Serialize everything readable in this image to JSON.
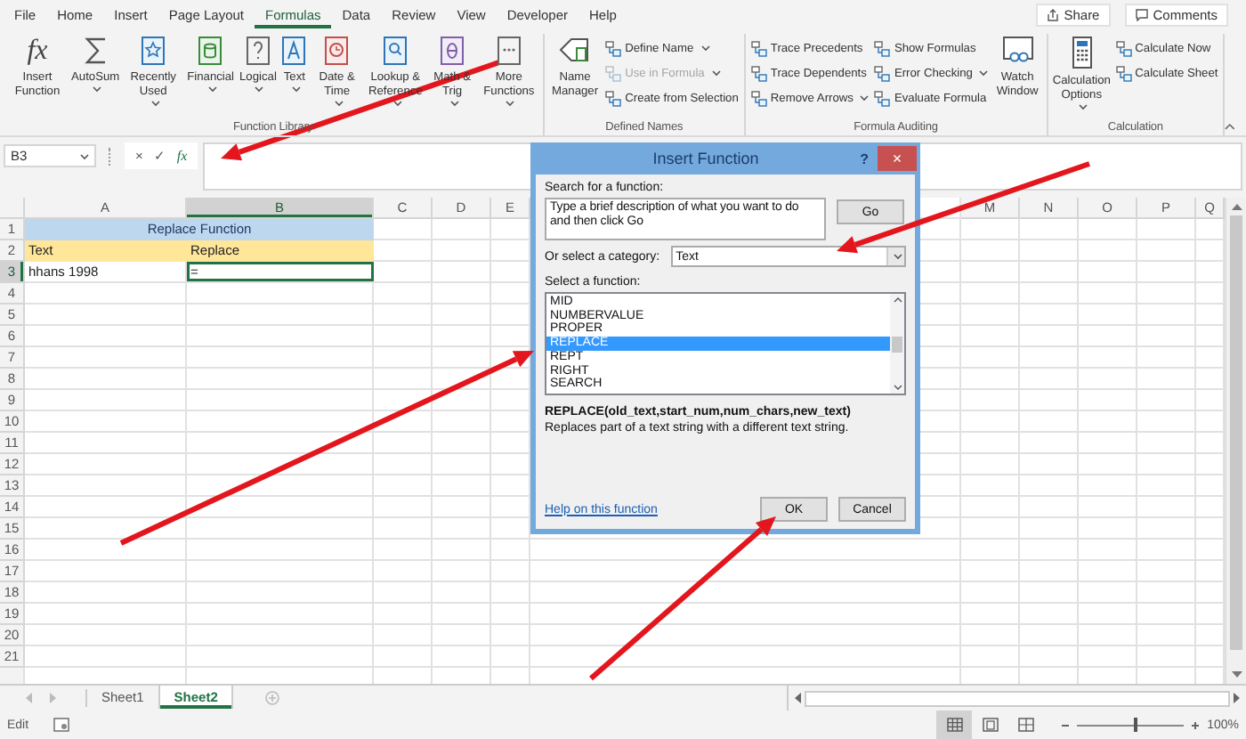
{
  "ribbon_tabs": [
    {
      "label": "File",
      "selected": false
    },
    {
      "label": "Home",
      "selected": false
    },
    {
      "label": "Insert",
      "selected": false
    },
    {
      "label": "Page Layout",
      "selected": false
    },
    {
      "label": "Formulas",
      "selected": true
    },
    {
      "label": "Data",
      "selected": false
    },
    {
      "label": "Review",
      "selected": false
    },
    {
      "label": "View",
      "selected": false
    },
    {
      "label": "Developer",
      "selected": false
    },
    {
      "label": "Help",
      "selected": false
    }
  ],
  "share": "Share",
  "comments": "Comments",
  "ribbon_groups": [
    {
      "label": "Function Library",
      "items": [
        {
          "kind": "large",
          "label": "Insert Function",
          "glyph": "fx",
          "dropdown": false,
          "disabled": false
        },
        {
          "kind": "large",
          "label": "AutoSum",
          "dropdown": true,
          "disabled": false
        },
        {
          "kind": "large",
          "label": "Recently Used",
          "dropdown": true,
          "disabled": false
        },
        {
          "kind": "large",
          "label": "Financial",
          "dropdown": true,
          "disabled": false
        },
        {
          "kind": "large",
          "label": "Logical",
          "dropdown": true,
          "disabled": false
        },
        {
          "kind": "large",
          "label": "Text",
          "dropdown": true,
          "disabled": false
        },
        {
          "kind": "large",
          "label": "Date & Time",
          "dropdown": true,
          "disabled": false
        },
        {
          "kind": "large",
          "label": "Lookup & Reference",
          "dropdown": true,
          "disabled": false
        },
        {
          "kind": "large",
          "label": "Math & Trig",
          "dropdown": true,
          "disabled": false
        },
        {
          "kind": "large",
          "label": "More Functions",
          "dropdown": true,
          "disabled": false
        }
      ]
    },
    {
      "label": "Defined Names",
      "items": [
        {
          "kind": "large",
          "label": "Name Manager",
          "dropdown": false,
          "disabled": false
        },
        {
          "kind": "small",
          "label": "Define Name",
          "dropdown": true,
          "disabled": false
        },
        {
          "kind": "small",
          "label": "Use in Formula",
          "dropdown": true,
          "disabled": true
        },
        {
          "kind": "small",
          "label": "Create from Selection",
          "dropdown": false,
          "disabled": false
        }
      ]
    },
    {
      "label": "Formula Auditing",
      "items": [
        {
          "kind": "small",
          "label": "Trace Precedents",
          "dropdown": false,
          "disabled": false
        },
        {
          "kind": "small",
          "label": "Trace Dependents",
          "dropdown": false,
          "disabled": false
        },
        {
          "kind": "small",
          "label": "Remove Arrows",
          "dropdown": true,
          "disabled": false
        },
        {
          "kind": "small",
          "label": "Show Formulas",
          "dropdown": false,
          "disabled": false
        },
        {
          "kind": "small",
          "label": "Error Checking",
          "dropdown": true,
          "disabled": false
        },
        {
          "kind": "small",
          "label": "Evaluate Formula",
          "dropdown": false,
          "disabled": false
        },
        {
          "kind": "large",
          "label": "Watch Window",
          "dropdown": false,
          "disabled": false
        }
      ]
    },
    {
      "label": "Calculation",
      "items": [
        {
          "kind": "large",
          "label": "Calculation Options",
          "dropdown": true,
          "disabled": false
        },
        {
          "kind": "small",
          "label": "Calculate Now",
          "dropdown": false,
          "disabled": false
        },
        {
          "kind": "small",
          "label": "Calculate Sheet",
          "dropdown": false,
          "disabled": false
        }
      ]
    }
  ],
  "formula_bar": {
    "name_box": "B3",
    "cancel": "×",
    "enter": "✓",
    "function": "fx"
  },
  "sheet": {
    "columns": [
      {
        "label": "A",
        "selected": false
      },
      {
        "label": "B",
        "selected": true
      },
      {
        "label": "C",
        "selected": false
      },
      {
        "label": "D",
        "selected": false
      },
      {
        "label": "E",
        "selected": false
      },
      {
        "label": "M",
        "selected": false
      },
      {
        "label": "N",
        "selected": false
      },
      {
        "label": "O",
        "selected": false
      },
      {
        "label": "P",
        "selected": false
      },
      {
        "label": "Q",
        "selected": false
      }
    ],
    "rows": [
      {
        "number": "1",
        "selected": false,
        "cells": [
          {
            "text": "Replace Function",
            "kind": "title",
            "selected": false
          }
        ]
      },
      {
        "number": "2",
        "selected": false,
        "cells": [
          {
            "text": "Text",
            "kind": "heading",
            "selected": false
          },
          {
            "text": "Replace",
            "kind": "heading",
            "selected": false
          }
        ]
      },
      {
        "number": "3",
        "selected": true,
        "cells": [
          {
            "text": "hhans 1998",
            "kind": "value",
            "selected": false
          },
          {
            "text": "=",
            "kind": "value",
            "selected": true
          }
        ]
      },
      {
        "number": "4",
        "selected": false
      },
      {
        "number": "5",
        "selected": false
      },
      {
        "number": "6",
        "selected": false
      },
      {
        "number": "7",
        "selected": false
      },
      {
        "number": "8",
        "selected": false
      },
      {
        "number": "9",
        "selected": false
      },
      {
        "number": "10",
        "selected": false
      },
      {
        "number": "11",
        "selected": false
      },
      {
        "number": "12",
        "selected": false
      },
      {
        "number": "13",
        "selected": false
      },
      {
        "number": "14",
        "selected": false
      },
      {
        "number": "15",
        "selected": false
      },
      {
        "number": "16",
        "selected": false
      },
      {
        "number": "17",
        "selected": false
      },
      {
        "number": "18",
        "selected": false
      },
      {
        "number": "19",
        "selected": false
      },
      {
        "number": "20",
        "selected": false
      },
      {
        "number": "21",
        "selected": false
      }
    ]
  },
  "dialog": {
    "title": "Insert Function",
    "help": "?",
    "close": "×",
    "search_label": "Search for a function:",
    "search_value": "Type a brief description of what you want to do and then click Go",
    "go": "Go",
    "category_label": "Or select a category:",
    "category": "Text",
    "function_label": "Select a function:",
    "functions": [
      {
        "name": "MID",
        "selected": false
      },
      {
        "name": "NUMBERVALUE",
        "selected": false
      },
      {
        "name": "PROPER",
        "selected": false
      },
      {
        "name": "REPLACE",
        "selected": true
      },
      {
        "name": "REPT",
        "selected": false
      },
      {
        "name": "RIGHT",
        "selected": false
      },
      {
        "name": "SEARCH",
        "selected": false
      }
    ],
    "signature": "REPLACE(old_text,start_num,num_chars,new_text)",
    "description": "Replaces part of a text string with a different text string.",
    "help_link": "Help on this function",
    "buttons": [
      "OK",
      "Cancel"
    ]
  },
  "sheet_tabs": [
    {
      "label": "Sheet1",
      "selected": false
    },
    {
      "label": "Sheet2",
      "selected": true
    }
  ],
  "status": {
    "mode": "Edit",
    "views": [
      {
        "selected": true
      },
      {
        "selected": false
      },
      {
        "selected": false
      }
    ],
    "zoom": {
      "level": 0.55
    },
    "zoom_label": "100%"
  }
}
